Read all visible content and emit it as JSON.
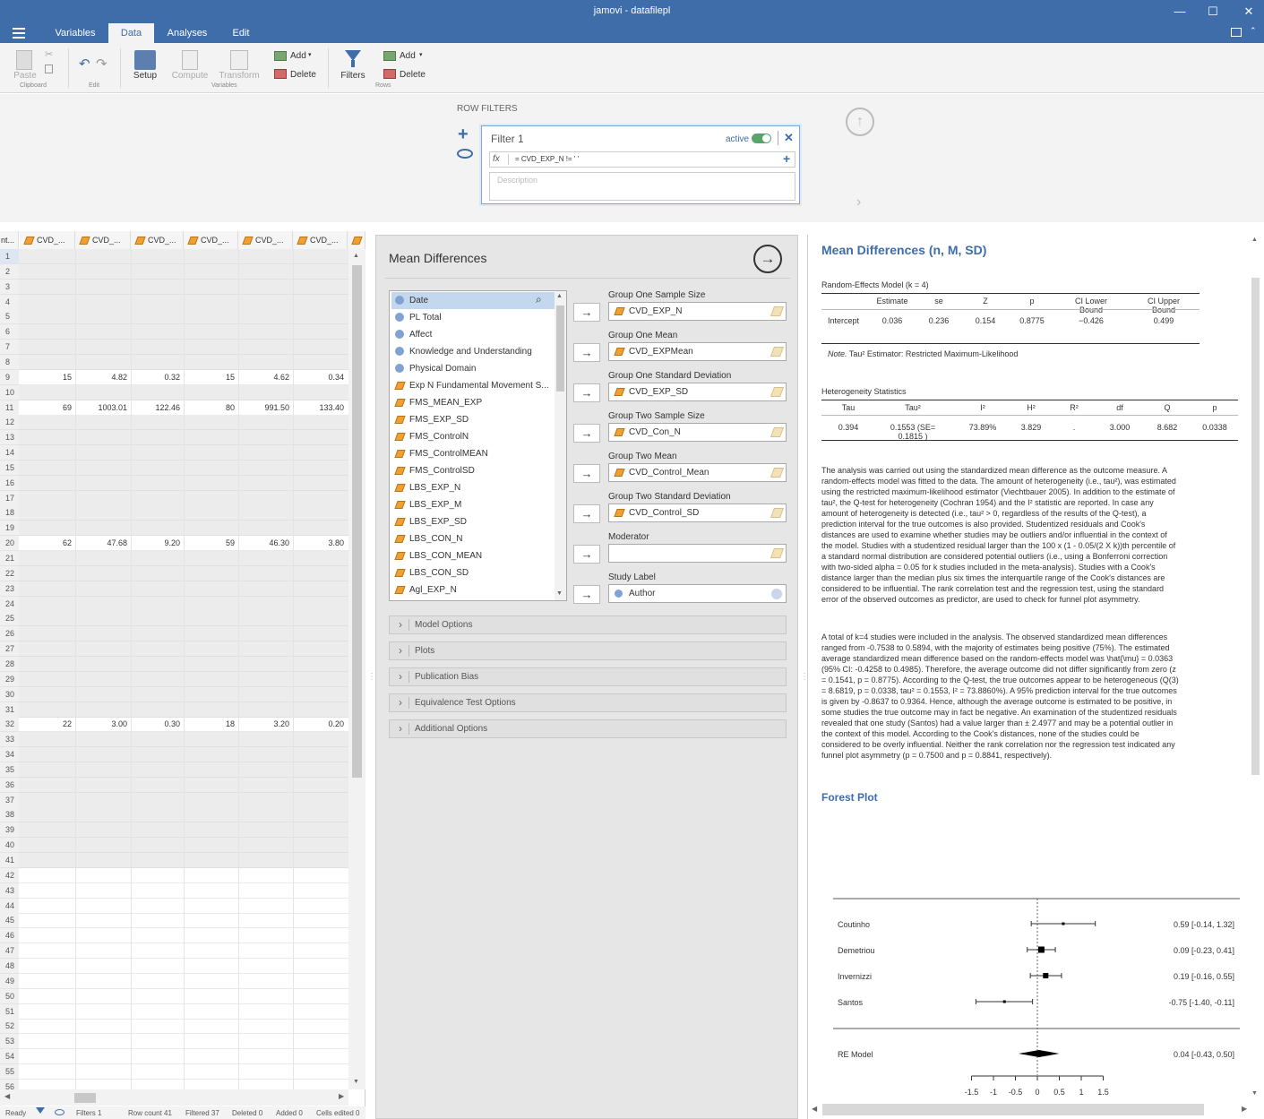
{
  "window": {
    "title": "jamovi - datafilepl",
    "minimize": "—",
    "maximize": "☐",
    "close": "✕"
  },
  "menu": {
    "tabs": [
      "Variables",
      "Data",
      "Analyses",
      "Edit"
    ],
    "active": "Data"
  },
  "ribbon": {
    "paste": "Paste",
    "clipboard_group": "Clipboard",
    "edit_group": "Edit",
    "setup": "Setup",
    "compute": "Compute",
    "transform": "Transform",
    "variables_group": "Variables",
    "add_var": "Add",
    "delete_var": "Delete",
    "filters": "Filters",
    "add_row": "Add",
    "delete_row": "Delete",
    "rows_group": "Rows"
  },
  "row_filters": {
    "heading": "ROW FILTERS",
    "filter_name": "Filter 1",
    "active_label": "active",
    "expression": "= CVD_EXP_N  !=  ' '",
    "description_placeholder": "Description",
    "fx": "fx"
  },
  "grid": {
    "first_header": "nt...",
    "headers": [
      "CVD_...",
      "CVD_...",
      "CVD_...",
      "CVD_...",
      "CVD_...",
      "CVD_..."
    ],
    "row_count": 56,
    "data_rows": [
      {
        "row": 9,
        "values": [
          "15",
          "4.82",
          "0.32",
          "15",
          "4.62",
          "0.34"
        ]
      },
      {
        "row": 11,
        "values": [
          "69",
          "1003.01",
          "122.46",
          "80",
          "991.50",
          "133.40"
        ]
      },
      {
        "row": 20,
        "values": [
          "62",
          "47.68",
          "9.20",
          "59",
          "46.30",
          "3.80"
        ]
      },
      {
        "row": 32,
        "values": [
          "22",
          "3.00",
          "0.30",
          "18",
          "3.20",
          "0.20"
        ]
      }
    ]
  },
  "status": {
    "ready": "Ready",
    "filters": "Filters 1",
    "row_count": "Row count 41",
    "filtered": "Filtered 37",
    "deleted": "Deleted 0",
    "added": "Added 0",
    "cells_edited": "Cells edited 0"
  },
  "analysis": {
    "title": "Mean Differences",
    "variables": [
      {
        "name": "Date",
        "type": "nominal"
      },
      {
        "name": "PL Total",
        "type": "nominal"
      },
      {
        "name": "Affect",
        "type": "nominal"
      },
      {
        "name": "Knowledge and Understanding",
        "type": "nominal"
      },
      {
        "name": "Physical Domain",
        "type": "nominal"
      },
      {
        "name": "Exp N Fundamental Movement S...",
        "type": "continuous"
      },
      {
        "name": "FMS_MEAN_EXP",
        "type": "continuous"
      },
      {
        "name": "FMS_EXP_SD",
        "type": "continuous"
      },
      {
        "name": "FMS_ControlN",
        "type": "continuous"
      },
      {
        "name": "FMS_ControlMEAN",
        "type": "continuous"
      },
      {
        "name": "FMS_ControlSD",
        "type": "continuous"
      },
      {
        "name": "LBS_EXP_N",
        "type": "continuous"
      },
      {
        "name": "LBS_EXP_M",
        "type": "continuous"
      },
      {
        "name": "LBS_EXP_SD",
        "type": "continuous"
      },
      {
        "name": "LBS_CON_N",
        "type": "continuous"
      },
      {
        "name": "LBS_CON_MEAN",
        "type": "continuous"
      },
      {
        "name": "LBS_CON_SD",
        "type": "continuous"
      },
      {
        "name": "Agl_EXP_N",
        "type": "continuous"
      }
    ],
    "targets": [
      {
        "label": "Group One Sample Size",
        "value": "CVD_EXP_N"
      },
      {
        "label": "Group One Mean",
        "value": "CVD_EXPMean"
      },
      {
        "label": "Group One Standard Deviation",
        "value": "CVD_EXP_SD"
      },
      {
        "label": "Group Two Sample Size",
        "value": "CVD_Con_N"
      },
      {
        "label": "Group Two Mean",
        "value": "CVD_Control_Mean"
      },
      {
        "label": "Group Two Standard Deviation",
        "value": "CVD_Control_SD"
      },
      {
        "label": "Moderator",
        "value": ""
      },
      {
        "label": "Study Label",
        "value": "Author"
      }
    ],
    "sections": [
      "Model Options",
      "Plots",
      "Publication Bias",
      "Equivalence Test Options",
      "Additional Options"
    ]
  },
  "results": {
    "title": "Mean Differences (n, M, SD)",
    "re_table": {
      "caption": "Random-Effects Model (k = 4)",
      "headers": [
        "Estimate",
        "se",
        "Z",
        "p",
        "CI Lower Bound",
        "CI Upper Bound"
      ],
      "row_label": "Intercept",
      "values": [
        "0.036",
        "0.236",
        "0.154",
        "0.8775",
        "−0.426",
        "0.499"
      ],
      "note_prefix": "Note.",
      "note": "Tau² Estimator: Restricted Maximum-Likelihood"
    },
    "het_table": {
      "caption": "Heterogeneity Statistics",
      "headers": [
        "Tau",
        "Tau²",
        "I²",
        "H²",
        "R²",
        "df",
        "Q",
        "p"
      ],
      "values": [
        "0.394",
        "0.1553 (SE= 0.1815 )",
        "73.89%",
        "3.829",
        ".",
        "3.000",
        "8.682",
        "0.0338"
      ]
    },
    "paragraph1": "The analysis was carried out using the standardized mean difference as the outcome measure. A random-effects model was fitted to the data. The amount of heterogeneity (i.e., tau²), was estimated using the restricted maximum-likelihood estimator (Viechtbauer 2005). In addition to the estimate of tau², the Q-test for heterogeneity (Cochran 1954) and the I² statistic are reported. In case any amount of heterogeneity is detected (i.e., tau² > 0, regardless of the results of the Q-test), a prediction interval for the true outcomes is also provided. Studentized residuals and Cook's distances are used to examine whether studies may be outliers and/or influential in the context of the model. Studies with a studentized residual larger than the 100 x (1 - 0.05/(2 X k))th percentile of a standard normal distribution are considered potential outliers (i.e., using a Bonferroni correction with two-sided alpha = 0.05 for k studies included in the meta-analysis). Studies with a Cook's distance larger than the median plus six times the interquartile range of the Cook's distances are considered to be influential. The rank correlation test and the regression test, using the standard error of the observed outcomes as predictor, are used to check for funnel plot asymmetry.",
    "paragraph2": "A total of k=4 studies were included in the analysis. The observed standardized mean differences ranged from -0.7538 to 0.5894, with the majority of estimates being positive (75%). The estimated average standardized mean difference based on the random-effects model was \\hat{\\mu} = 0.0363 (95% CI: -0.4258 to 0.4985). Therefore, the average outcome did not differ significantly from zero (z = 0.1541, p = 0.8775). According to the Q-test, the true outcomes appear to be heterogeneous (Q(3) = 8.6819, p = 0.0338, tau² = 0.1553, I² = 73.8860%). A 95% prediction interval for the true outcomes is given by -0.8637 to 0.9364. Hence, although the average outcome is estimated to be positive, in some studies the true outcome may in fact be negative. An examination of the studentized residuals revealed that one study (Santos) had a value larger than ± 2.4977 and may be a potential outlier in the context of this model. According to the Cook's distances, none of the studies could be considered to be overly influential. Neither the rank correlation nor the regression test indicated any funnel plot asymmetry (p = 0.7500 and p = 0.8841, respectively).",
    "forest_title": "Forest Plot"
  },
  "chart_data": {
    "type": "scatter",
    "studies": [
      {
        "name": "Coutinho",
        "estimate": 0.59,
        "lower": -0.14,
        "upper": 1.32,
        "label": "0.59 [-0.14,  1.32]"
      },
      {
        "name": "Demetriou",
        "estimate": 0.09,
        "lower": -0.23,
        "upper": 0.41,
        "label": "0.09 [-0.23,  0.41]"
      },
      {
        "name": "Invernizzi",
        "estimate": 0.19,
        "lower": -0.16,
        "upper": 0.55,
        "label": "0.19 [-0.16,  0.55]"
      },
      {
        "name": "Santos",
        "estimate": -0.75,
        "lower": -1.4,
        "upper": -0.11,
        "label": "-0.75 [-1.40, -0.11]"
      }
    ],
    "summary": {
      "name": "RE Model",
      "estimate": 0.04,
      "lower": -0.43,
      "upper": 0.5,
      "label": "0.04 [-0.43,  0.50]"
    },
    "xticks": [
      "-1.5",
      "-1",
      "-0.5",
      "0",
      "0.5",
      "1",
      "1.5"
    ],
    "xlim": [
      -1.5,
      1.5
    ]
  },
  "colors": {
    "accent": "#3e6da9",
    "toggle": "#5aa46a"
  }
}
